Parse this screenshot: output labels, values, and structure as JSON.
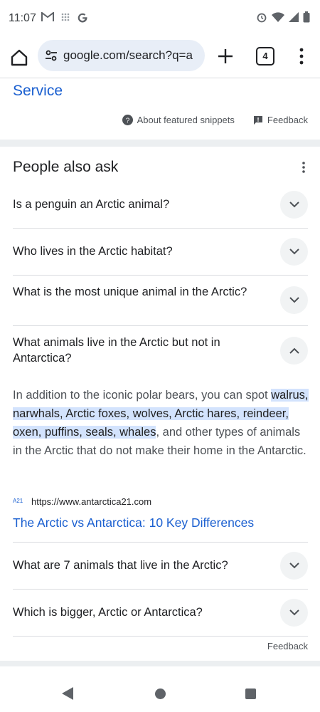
{
  "status_bar": {
    "time": "11:07",
    "left_icons": [
      "gmail-icon",
      "grid-icon",
      "google-icon"
    ],
    "right_icons": [
      "alarm-icon",
      "wifi-icon",
      "signal-icon",
      "battery-icon"
    ]
  },
  "toolbar": {
    "url": "google.com/search?q=a",
    "tab_count": "4"
  },
  "top_link": "Service",
  "snippets": {
    "about_label": "About featured snippets",
    "feedback_label": "Feedback"
  },
  "paa": {
    "title": "People also ask",
    "questions": [
      {
        "text": "Is a penguin an Arctic animal?",
        "expanded": false
      },
      {
        "text": "Who lives in the Arctic habitat?",
        "expanded": false
      },
      {
        "text": "What is the most unique animal in the Arctic?",
        "expanded": false
      },
      {
        "text": "What animals live in the Arctic but not in Antarctica?",
        "expanded": true
      },
      {
        "text": "What are 7 animals that live in the Arctic?",
        "expanded": false
      },
      {
        "text": "Which is bigger, Arctic or Antarctica?",
        "expanded": false
      }
    ],
    "answer": {
      "before": "In addition to the iconic polar bears, you can spot ",
      "highlight": "walrus, narwhals, Arctic foxes, wolves, Arctic hares, reindeer, oxen, puffins, seals, whales",
      "after": ", and other types of animals in the Arctic that do not make their home in the Antarctic.",
      "source_icon_text": "A21",
      "source_url": "https://www.antarctica21.com",
      "source_title": "The Arctic vs Antarctica: 10 Key Differences"
    },
    "feedback_label": "Feedback"
  },
  "colors": {
    "link": "#1a5fd0",
    "highlight": "#d3e3fd",
    "url_bar_bg": "#e8eef7"
  }
}
